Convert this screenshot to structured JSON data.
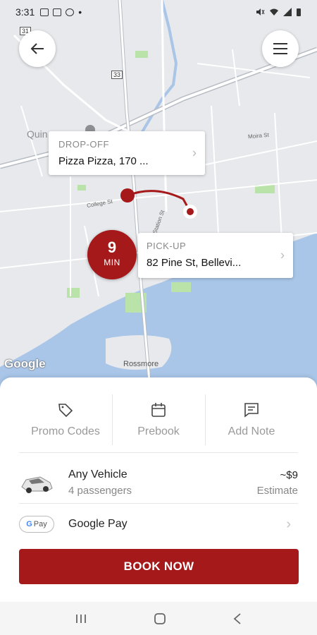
{
  "status_bar": {
    "time": "3:31",
    "dot": "•"
  },
  "map": {
    "labels": {
      "quinte": "Quin",
      "rossmore": "Rossmore",
      "college": "College St",
      "station": "Station St",
      "moira": "Moira St",
      "hwy31": "31",
      "hwy33": "33"
    },
    "attribution": "Google"
  },
  "dropoff": {
    "caption": "DROP-OFF",
    "address": "Pizza Pizza, 170 ..."
  },
  "pickup": {
    "caption": "PICK-UP",
    "address": "82 Pine St, Bellevi..."
  },
  "eta": {
    "value": "9",
    "unit": "MIN"
  },
  "options": [
    {
      "label": "Promo Codes",
      "icon": "tag-icon"
    },
    {
      "label": "Prebook",
      "icon": "calendar-icon"
    },
    {
      "label": "Add Note",
      "icon": "message-icon"
    }
  ],
  "vehicle": {
    "title": "Any Vehicle",
    "subtitle": "4 passengers",
    "price": "~$9",
    "price_note": "Estimate"
  },
  "payment": {
    "chip_g": "G",
    "chip_text": "Pay",
    "label": "Google Pay"
  },
  "book_button": "BOOK NOW",
  "colors": {
    "accent": "#a5191b",
    "water": "#a9c6e8",
    "park": "#b9e3a8"
  }
}
